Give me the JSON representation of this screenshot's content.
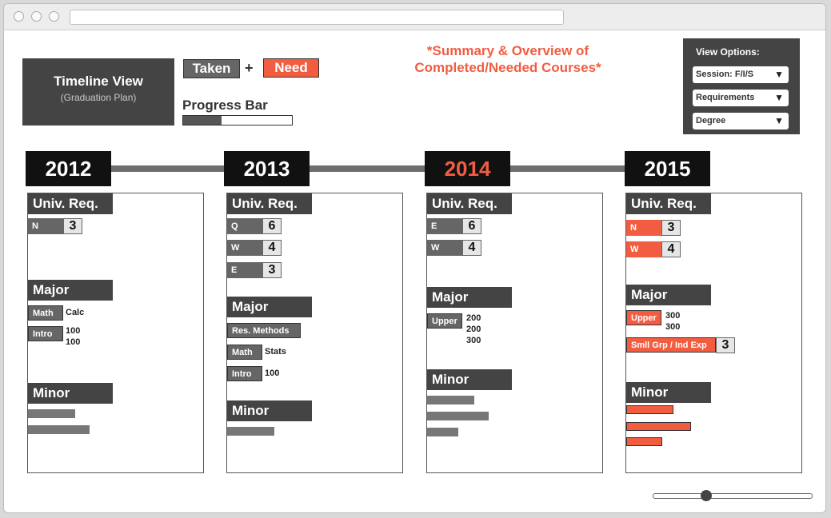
{
  "header": {
    "title": "Timeline View",
    "subtitle": "(Graduation Plan)",
    "legend_taken": "Taken",
    "legend_plus": "+",
    "legend_need": "Need",
    "progress_label": "Progress Bar",
    "progress_fraction": 0.35,
    "summary_line1": "*Summary & Overview of",
    "summary_line2": "Completed/Needed Courses*"
  },
  "view_options": {
    "heading": "View Options:",
    "selects": [
      "Session: F/I/S",
      "Requirements",
      "Degree"
    ],
    "caret": "▼"
  },
  "colors": {
    "need": "#f25d42",
    "taken": "#666666"
  },
  "years": [
    {
      "year": "2012",
      "univ_title": "Univ. Req.",
      "univ": [
        {
          "code": "N",
          "count": "3"
        }
      ],
      "major_title": "Major",
      "major": [
        {
          "tag": "Math",
          "lines": [
            "Calc"
          ]
        },
        {
          "tag": "Intro",
          "lines": [
            "100",
            "100"
          ]
        }
      ],
      "minor_title": "Minor",
      "minor_fill": [
        0.42,
        0.55
      ]
    },
    {
      "year": "2013",
      "univ_title": "Univ. Req.",
      "univ": [
        {
          "code": "Q",
          "count": "6"
        },
        {
          "code": "W",
          "count": "4"
        },
        {
          "code": "E",
          "count": "3"
        }
      ],
      "major_title": "Major",
      "major": [
        {
          "tag": "Res. Methods",
          "lines": []
        },
        {
          "tag": "Math",
          "lines": [
            "Stats"
          ]
        },
        {
          "tag": "Intro",
          "lines": [
            "100"
          ]
        }
      ],
      "minor_title": "Minor",
      "minor_fill": [
        0.42
      ]
    },
    {
      "year": "2014",
      "univ_title": "Univ. Req.",
      "univ": [
        {
          "code": "E",
          "count": "6"
        },
        {
          "code": "W",
          "count": "4"
        }
      ],
      "major_title": "Major",
      "major": [
        {
          "tag": "Upper",
          "lines": [
            "200",
            "200",
            "300"
          ]
        }
      ],
      "minor_title": "Minor",
      "minor_fill": [
        0.42,
        0.55,
        0.28
      ]
    },
    {
      "year": "2015",
      "univ_title": "Univ. Req.",
      "univ": [
        {
          "code": "N",
          "count": "3"
        },
        {
          "code": "W",
          "count": "4"
        }
      ],
      "major_title": "Major",
      "major": [
        {
          "tag": "Upper",
          "lines": [
            "300",
            "300"
          ]
        },
        {
          "tag": "Smll Grp / Ind Exp",
          "count": "3"
        }
      ],
      "minor_title": "Minor",
      "minor_fill": [
        0.42,
        0.58,
        0.32
      ]
    }
  ],
  "zoom_slider": 0.34
}
